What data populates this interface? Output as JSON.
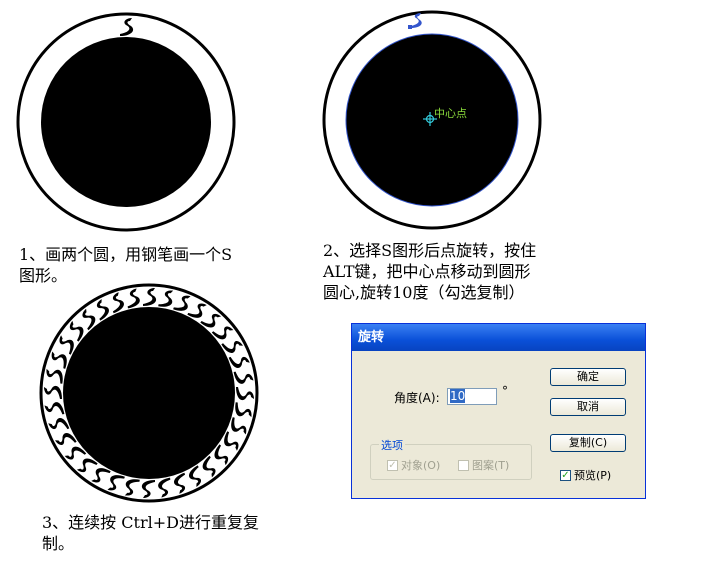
{
  "figure1": {
    "caption": [
      "1、画两个圆，用钢笔画一个S",
      "图形。"
    ]
  },
  "figure2": {
    "center_label": "中心点",
    "caption": [
      "2、选择S图形后点旋转，按住",
      "ALT键，把中心点移动到圆形",
      "圆心,旋转10度（勾选复制）"
    ]
  },
  "figure3": {
    "caption": [
      "3、连续按 Ctrl+D进行重复复",
      "制。"
    ],
    "copies": 36,
    "rotation_step_deg": 10
  },
  "dialog": {
    "title": "旋转",
    "angle_label": "角度(A):",
    "angle_value": "10",
    "degree_symbol": "°",
    "ok_button": "确定",
    "cancel_button": "取消",
    "copy_button": "复制(C)",
    "preview_label": "预览(P)",
    "preview_checked": true,
    "options_group": "选项",
    "option_objects": "对象(O)",
    "option_objects_checked": true,
    "option_pattern": "图案(T)",
    "option_pattern_checked": false
  },
  "colors": {
    "selection": "#3355cc",
    "center_point": "#33ccdd"
  }
}
